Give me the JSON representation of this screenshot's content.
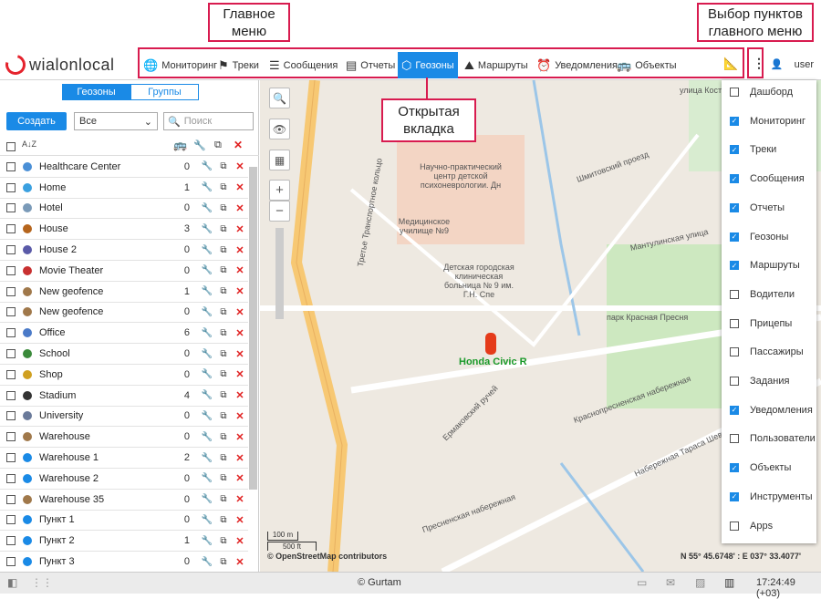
{
  "annotations": {
    "main_menu": "Главное меню",
    "pick_items": "Выбор пунктов главного меню",
    "open_tab": "Открытая вкладка"
  },
  "brand": "wialonlocal",
  "tabs": [
    {
      "label": "Мониторинг",
      "icon": "globe-icon"
    },
    {
      "label": "Треки",
      "icon": "flag-icon"
    },
    {
      "label": "Сообщения",
      "icon": "message-icon"
    },
    {
      "label": "Отчеты",
      "icon": "report-icon"
    },
    {
      "label": "Геозоны",
      "icon": "geofence-icon",
      "active": true
    },
    {
      "label": "Маршруты",
      "icon": "route-icon"
    },
    {
      "label": "Уведомления",
      "icon": "alarm-icon"
    },
    {
      "label": "Объекты",
      "icon": "bus-icon"
    }
  ],
  "user": "user",
  "sidebar": {
    "seg": [
      "Геозоны",
      "Группы"
    ],
    "create": "Создать",
    "filter": "Все",
    "search_placeholder": "Поиск",
    "rows": [
      {
        "name": "Healthcare Center",
        "count": "0",
        "color": "#4a8fd6"
      },
      {
        "name": "Home",
        "count": "1",
        "color": "#3aa0e0"
      },
      {
        "name": "Hotel",
        "count": "0",
        "color": "#7a9ab8"
      },
      {
        "name": "House",
        "count": "3",
        "color": "#b5651d"
      },
      {
        "name": "House 2",
        "count": "0",
        "color": "#5a5aa8"
      },
      {
        "name": "Movie Theater",
        "count": "0",
        "color": "#c83030"
      },
      {
        "name": "New geofence",
        "count": "1",
        "color": "#a0784a"
      },
      {
        "name": "New geofence",
        "count": "0",
        "color": "#a0784a"
      },
      {
        "name": "Office",
        "count": "6",
        "color": "#4a7ac8"
      },
      {
        "name": "School",
        "count": "0",
        "color": "#3a8a3a"
      },
      {
        "name": "Shop",
        "count": "0",
        "color": "#d0a020"
      },
      {
        "name": "Stadium",
        "count": "4",
        "color": "#333333"
      },
      {
        "name": "University",
        "count": "0",
        "color": "#6a7a9a"
      },
      {
        "name": "Warehouse",
        "count": "0",
        "color": "#a0784a"
      },
      {
        "name": "Warehouse 1",
        "count": "2",
        "color": "#1a8ae6"
      },
      {
        "name": "Warehouse 2",
        "count": "0",
        "color": "#1a8ae6"
      },
      {
        "name": "Warehouse 35",
        "count": "0",
        "color": "#a0784a"
      },
      {
        "name": "Пункт 1",
        "count": "0",
        "color": "#1a8ae6"
      },
      {
        "name": "Пункт 2",
        "count": "1",
        "color": "#1a8ae6"
      },
      {
        "name": "Пункт 3",
        "count": "0",
        "color": "#1a8ae6"
      }
    ]
  },
  "menu_items": [
    {
      "label": "Дашборд",
      "checked": false
    },
    {
      "label": "Мониторинг",
      "checked": true
    },
    {
      "label": "Треки",
      "checked": true
    },
    {
      "label": "Сообщения",
      "checked": true
    },
    {
      "label": "Отчеты",
      "checked": true
    },
    {
      "label": "Геозоны",
      "checked": true
    },
    {
      "label": "Маршруты",
      "checked": true
    },
    {
      "label": "Водители",
      "checked": false
    },
    {
      "label": "Прицепы",
      "checked": false
    },
    {
      "label": "Пассажиры",
      "checked": false
    },
    {
      "label": "Задания",
      "checked": false
    },
    {
      "label": "Уведомления",
      "checked": true
    },
    {
      "label": "Пользователи",
      "checked": false
    },
    {
      "label": "Объекты",
      "checked": true
    },
    {
      "label": "Инструменты",
      "checked": true
    },
    {
      "label": "Apps",
      "checked": false
    }
  ],
  "map": {
    "unit_label": "Honda Civic R",
    "scale_m": "100 m",
    "scale_ft": "500 ft",
    "attribution": "© OpenStreetMap contributors",
    "coords": "N 55° 45.6748' : E 037° 33.4077'",
    "labels": [
      "Научно-практический центр детской психоневрологии. Дн",
      "Медицинское училище №9",
      "Детская городская клиническая больница № 9 им. Г.Н. Спе",
      "парк Красная Пресня",
      "Мантулинская улица",
      "Шмитовский проезд",
      "Краснопресненская набережная",
      "Набережная Тараса Шевченко",
      "Третье Транспортное кольцо",
      "Пресненская набережная",
      "Ермаковский ручей",
      "улица Костикова"
    ]
  },
  "status": {
    "copyright": "© Gurtam",
    "time": "17:24:49 (+03)"
  }
}
